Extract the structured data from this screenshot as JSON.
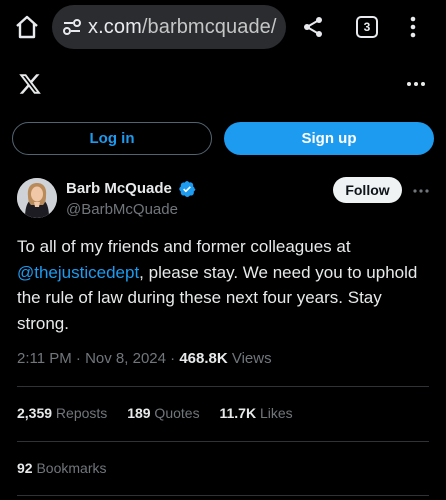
{
  "browser": {
    "url_host": "x.com",
    "url_path": "/barbmcquade/",
    "tab_count": "3",
    "icons": [
      "home-icon",
      "site-settings-icon",
      "share-icon",
      "tabs-icon",
      "more-vertical-icon"
    ]
  },
  "header": {
    "logo": "X",
    "more_icon": "more-horizontal-icon"
  },
  "auth": {
    "login_label": "Log in",
    "signup_label": "Sign up"
  },
  "tweet": {
    "author_name": "Barb McQuade",
    "author_handle": "@BarbMcQuade",
    "verified": true,
    "follow_label": "Follow",
    "text_before": "To all of my friends and former colleagues at ",
    "mention": "@thejusticedept",
    "text_after": ", please stay. We need you to uphold the rule of law during these next four years. Stay strong.",
    "time": "2:11 PM",
    "sep1": " · ",
    "date": "Nov 8, 2024",
    "sep2": " · ",
    "views_count": "468.8K",
    "views_label": " Views"
  },
  "stats": {
    "reposts_count": "2,359",
    "reposts_label": " Reposts",
    "quotes_count": "189",
    "quotes_label": " Quotes",
    "likes_count": "11.7K",
    "likes_label": " Likes",
    "bookmarks_count": "92",
    "bookmarks_label": " Bookmarks"
  },
  "colors": {
    "background": "#000000",
    "accent": "#1d9bf0",
    "text_primary": "#e7e9ea",
    "text_secondary": "#71767b"
  }
}
